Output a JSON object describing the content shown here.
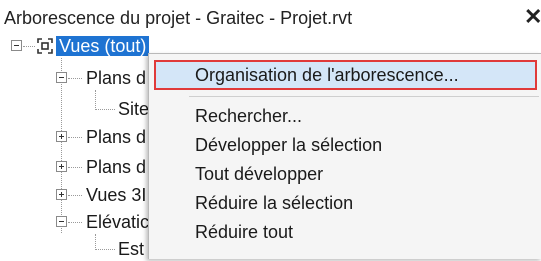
{
  "panel": {
    "title": "Arborescence du projet - Graitec - Projet.rvt",
    "close_glyph": "✕"
  },
  "tree": {
    "root": "Vues (tout)",
    "items": [
      {
        "label": "Plans d"
      },
      {
        "label": "Site"
      },
      {
        "label": "Plans d"
      },
      {
        "label": "Plans d"
      },
      {
        "label": "Vues 3I"
      },
      {
        "label": "Elévatic"
      },
      {
        "label": "Est"
      }
    ]
  },
  "context_menu": {
    "highlighted": "Organisation de l'arborescence...",
    "items": [
      "Rechercher...",
      "Développer la sélection",
      "Tout développer",
      "Réduire la sélection",
      "Réduire tout"
    ],
    "highlight_color": "#d4e6f8",
    "highlight_border_color": "#e03a3a"
  },
  "colors": {
    "selection": "#1e73d2"
  }
}
